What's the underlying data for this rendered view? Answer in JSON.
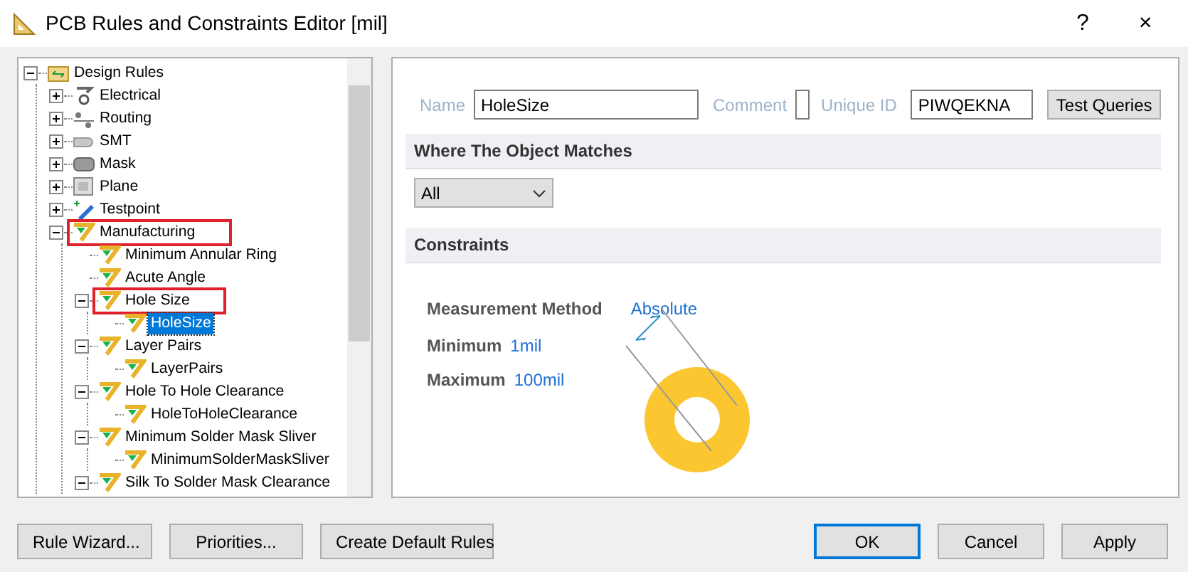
{
  "window": {
    "title": "PCB Rules and Constraints Editor [mil]",
    "help": "?",
    "close": "×"
  },
  "tree": [
    {
      "label": "Design Rules",
      "kind": "folder",
      "expanded": true,
      "selected": false,
      "boxed": false,
      "children": [
        {
          "label": "Electrical",
          "kind": "electrical",
          "expanded": false,
          "selected": false,
          "boxed": false
        },
        {
          "label": "Routing",
          "kind": "routing",
          "expanded": false,
          "selected": false,
          "boxed": false
        },
        {
          "label": "SMT",
          "kind": "smt",
          "expanded": false,
          "selected": false,
          "boxed": false
        },
        {
          "label": "Mask",
          "kind": "mask",
          "expanded": false,
          "selected": false,
          "boxed": false
        },
        {
          "label": "Plane",
          "kind": "plane",
          "expanded": false,
          "selected": false,
          "boxed": false
        },
        {
          "label": "Testpoint",
          "kind": "testpoint",
          "expanded": false,
          "selected": false,
          "boxed": false
        },
        {
          "label": "Manufacturing",
          "kind": "rule",
          "expanded": true,
          "selected": false,
          "boxed": true,
          "children": [
            {
              "label": "Minimum Annular Ring",
              "kind": "rule",
              "selected": false,
              "boxed": false
            },
            {
              "label": "Acute Angle",
              "kind": "rule",
              "selected": false,
              "boxed": false
            },
            {
              "label": "Hole Size",
              "kind": "rule",
              "expanded": true,
              "selected": false,
              "boxed": true,
              "children": [
                {
                  "label": "HoleSize",
                  "kind": "rule",
                  "selected": true,
                  "boxed": false
                }
              ]
            },
            {
              "label": "Layer Pairs",
              "kind": "rule",
              "expanded": true,
              "selected": false,
              "boxed": false,
              "children": [
                {
                  "label": "LayerPairs",
                  "kind": "rule",
                  "selected": false,
                  "boxed": false
                }
              ]
            },
            {
              "label": "Hole To Hole Clearance",
              "kind": "rule",
              "expanded": true,
              "selected": false,
              "boxed": false,
              "children": [
                {
                  "label": "HoleToHoleClearance",
                  "kind": "rule",
                  "selected": false,
                  "boxed": false
                }
              ]
            },
            {
              "label": "Minimum Solder Mask Sliver",
              "kind": "rule",
              "expanded": true,
              "selected": false,
              "boxed": false,
              "children": [
                {
                  "label": "MinimumSolderMaskSliver",
                  "kind": "rule",
                  "selected": false,
                  "boxed": false
                }
              ]
            },
            {
              "label": "Silk To Solder Mask Clearance",
              "kind": "rule",
              "expanded": true,
              "selected": false,
              "boxed": false
            }
          ]
        }
      ]
    }
  ],
  "rule": {
    "name_label": "Name",
    "name": "HoleSize",
    "comment_label": "Comment",
    "unique_id_label": "Unique ID",
    "unique_id": "PIWQEKNA",
    "test_button": "Test Queries"
  },
  "match": {
    "heading": "Where The Object Matches",
    "scope": "All"
  },
  "constraints": {
    "heading": "Constraints",
    "fields": [
      {
        "label": "Measurement Method",
        "value": "Absolute"
      },
      {
        "label": "Minimum",
        "value": "1mil"
      },
      {
        "label": "Maximum",
        "value": "100mil"
      }
    ]
  },
  "footer": [
    {
      "label": "Rule Wizard...",
      "default": false
    },
    {
      "label": "Priorities...",
      "default": false
    },
    {
      "label": "Create Default Rules",
      "default": false
    },
    {
      "label": "OK",
      "default": true
    },
    {
      "label": "Cancel",
      "default": false
    },
    {
      "label": "Apply",
      "default": false
    }
  ]
}
